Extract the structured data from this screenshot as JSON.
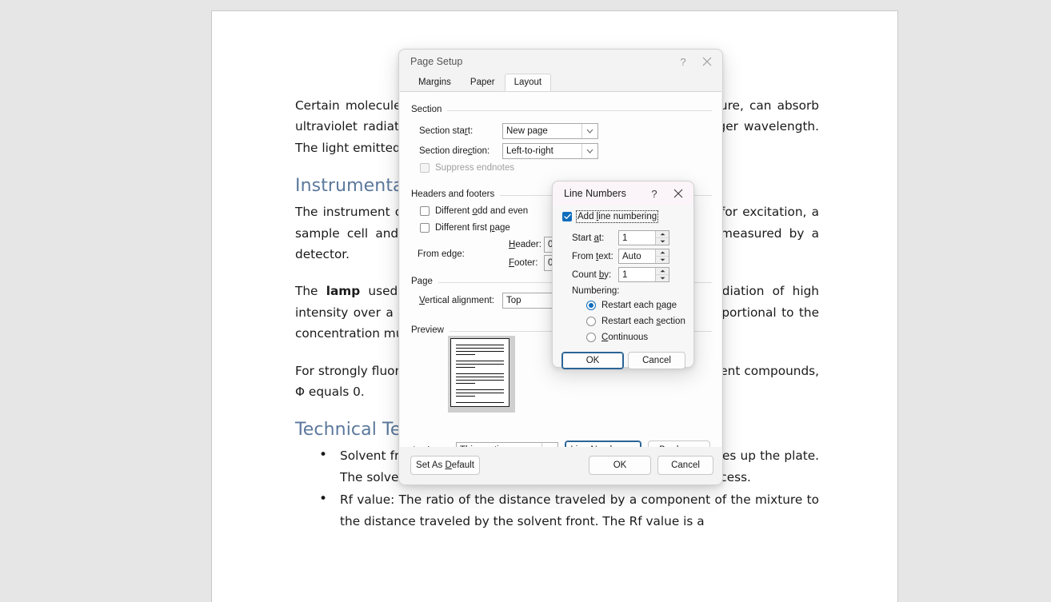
{
  "document": {
    "paragraphs": [
      {
        "id": "p1",
        "runs": [
          {
            "text": "Certain molecules with conjugated double bonds and a rigid structure, can absorb ultraviolet radiation and then emit the radiation absorbed at a longer wavelength. The light emitted can then be measured.",
            "bold": false
          }
        ]
      },
      {
        "id": "p2",
        "runs": [
          {
            "text": "The instrument consists of a light source, a wavelength to be used for excitation, a sample cell and a wavelength range of the light emitted to be measured by a detector.",
            "bold": false
          }
        ]
      },
      {
        "id": "p3",
        "runs": [
          {
            "text": "The ",
            "bold": false
          },
          {
            "text": "lamp",
            "bold": true
          },
          {
            "text": " used, usually a mercury or xenon lamp, produces radiation of high intensity over a wide range. The strength of the fluorescence is proportional to the concentration multiplied by the fluorescence quantum yield Φ.",
            "bold": false
          }
        ]
      },
      {
        "id": "p4",
        "runs": [
          {
            "text": "For strongly fluorescent compounds Φ approaches 1, for non-fluorescent compounds, Φ equals 0.",
            "bold": false
          }
        ]
      }
    ],
    "headings": {
      "instrumentation": "Instrumentation",
      "technical_terms": "Technical Terms"
    },
    "bullets": [
      "Solvent front: The leading edge of the mobile phase as it moves up the plate. The solvent front marks the end point of the development process.",
      "Rf value: The ratio of the distance traveled by a component of the mixture to the distance traveled by the solvent front. The Rf value is a"
    ]
  },
  "page_setup": {
    "title": "Page Setup",
    "help_glyph": "?",
    "tabs": [
      {
        "label": "Margins",
        "active": false
      },
      {
        "label": "Paper",
        "active": false
      },
      {
        "label": "Layout",
        "active": true
      }
    ],
    "section_group": {
      "label": "Section",
      "section_start": {
        "label_pre": "Section sta",
        "label_key": "r",
        "label_post": "t:",
        "value": "New page"
      },
      "section_direction": {
        "label_pre": "Section dire",
        "label_key": "c",
        "label_post": "tion:",
        "value": "Left-to-right"
      },
      "suppress_endnotes": {
        "label": "Suppress endnotes",
        "checked": false,
        "disabled": true
      }
    },
    "headers_footers_group": {
      "label": "Headers and footers",
      "different_odd_even": {
        "label_pre": "Different ",
        "label_key": "o",
        "label_post": "dd and even",
        "checked": false
      },
      "different_first_page": {
        "label_pre": "Different first ",
        "label_key": "p",
        "label_post": "age",
        "checked": false
      },
      "from_edge_label": "From edge:",
      "header": {
        "label_key": "H",
        "label_post": "eader:",
        "value": "0."
      },
      "footer": {
        "label_key": "F",
        "label_post": "ooter:",
        "value": "0."
      }
    },
    "page_group": {
      "label": "Page",
      "vertical_alignment": {
        "label_key": "V",
        "label_post": "ertical alignment:",
        "value": "Top"
      }
    },
    "preview_group": {
      "label": "Preview"
    },
    "apply_to": {
      "label_pre": "Apply ",
      "label_key": "t",
      "label_post": "o:",
      "value": "This section"
    },
    "line_numbers_button": {
      "label_pre": "Line ",
      "label_key": "N",
      "label_post": "umbers..."
    },
    "borders_button": {
      "label_key": "B",
      "label_post": "orders..."
    },
    "set_as_default_button": {
      "label_pre": "Set As ",
      "label_key": "D",
      "label_post": "efault"
    },
    "ok_button": "OK",
    "cancel_button": "Cancel"
  },
  "line_numbers": {
    "title": "Line Numbers",
    "help_glyph": "?",
    "add_line_numbering": {
      "label_pre": "Add ",
      "label_key": "l",
      "label_post": "ine numbering",
      "checked": true
    },
    "start_at": {
      "label_pre": "Start ",
      "label_key": "a",
      "label_post": "t:",
      "value": "1"
    },
    "from_text": {
      "label_pre": "From ",
      "label_key": "t",
      "label_post": "ext:",
      "value": "Auto"
    },
    "count_by": {
      "label_pre": "Count ",
      "label_key": "b",
      "label_post": "y:",
      "value": "1"
    },
    "numbering_label": "Numbering:",
    "options": [
      {
        "label_pre": "Restart each ",
        "label_key": "p",
        "label_post": "age",
        "selected": true
      },
      {
        "label_pre": "Restart each ",
        "label_key": "s",
        "label_post": "ection",
        "selected": false
      },
      {
        "label_pre": "",
        "label_key": "C",
        "label_post": "ontinuous",
        "selected": false
      }
    ],
    "ok_button": "OK",
    "cancel_button": "Cancel"
  },
  "colors": {
    "canvas": "#e6e6e6",
    "page": "#ffffff",
    "heading": "#5b789c",
    "accent": "#0f6cbd",
    "focus_border": "#2a6496",
    "dialog_bg": "#f3f3f3",
    "panel_bg": "#fdfdfd",
    "ln_title_bg": "#fbf4f8"
  }
}
